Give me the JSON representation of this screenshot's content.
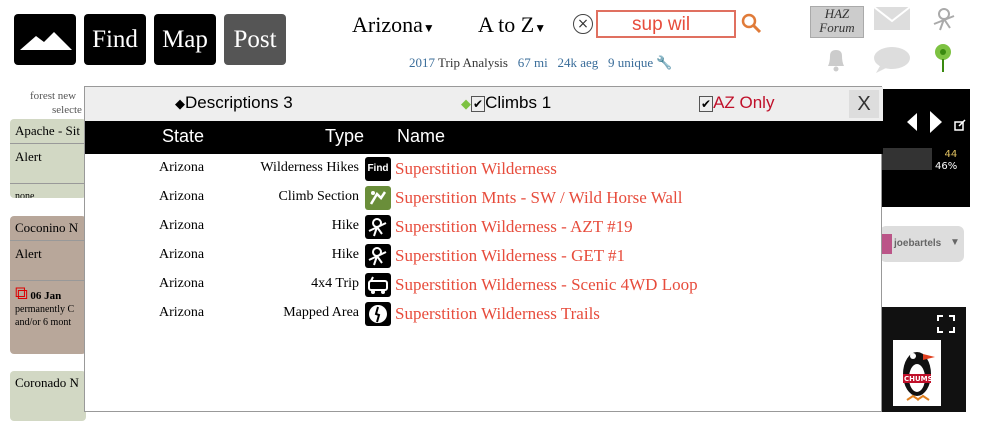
{
  "nav": {
    "find": "Find",
    "map": "Map",
    "post": "Post"
  },
  "region": {
    "state": "Arizona",
    "index": "A to Z"
  },
  "search": {
    "value": "sup wil"
  },
  "trip": {
    "year": "2017",
    "label": "Trip Analysis",
    "miles": "67 mi",
    "aeg": "24k aeg",
    "unique": "9 unique"
  },
  "forum": {
    "line1": "HAZ",
    "line2": "Forum"
  },
  "sidebar": {
    "forest_news_line1": "forest new",
    "forest_news_line2": "selecte",
    "cards": [
      {
        "title": "Apache - Sit",
        "alert": "Alert",
        "note": "none"
      },
      {
        "title": "Coconino N",
        "alert": "Alert",
        "date": "06 Jan",
        "note1": "permanently C",
        "note2": "and/or 6 mont"
      },
      {
        "title": "Coronado N"
      }
    ]
  },
  "right": {
    "num": "44",
    "pct": "46%",
    "user": "joebartels",
    "ad": "CHUMS"
  },
  "modal": {
    "tabs": {
      "descriptions": "Descriptions 3",
      "climbs": "Climbs 1",
      "az_only": "AZ Only"
    },
    "close": "X",
    "headers": {
      "state": "State",
      "type": "Type",
      "name": "Name"
    },
    "rows": [
      {
        "state": "Arizona",
        "type": "Wilderness Hikes",
        "icon": "find-icon",
        "icon_text": "Find",
        "name": "Superstition Wilderness"
      },
      {
        "state": "Arizona",
        "type": "Climb Section",
        "icon": "climb-icon",
        "icon_text": "",
        "name": "Superstition Mnts - SW / Wild Horse Wall"
      },
      {
        "state": "Arizona",
        "type": "Hike",
        "icon": "hike-icon",
        "icon_text": "",
        "name": "Superstition Wilderness - AZT #19"
      },
      {
        "state": "Arizona",
        "type": "Hike",
        "icon": "hike-icon",
        "icon_text": "",
        "name": "Superstition Wilderness - GET #1"
      },
      {
        "state": "Arizona",
        "type": "4x4 Trip",
        "icon": "jeep-icon",
        "icon_text": "",
        "name": "Superstition Wilderness - Scenic 4WD Loop"
      },
      {
        "state": "Arizona",
        "type": "Mapped Area",
        "icon": "mapped-area-icon",
        "icon_text": "",
        "name": "Superstition Wilderness Trails"
      }
    ]
  }
}
